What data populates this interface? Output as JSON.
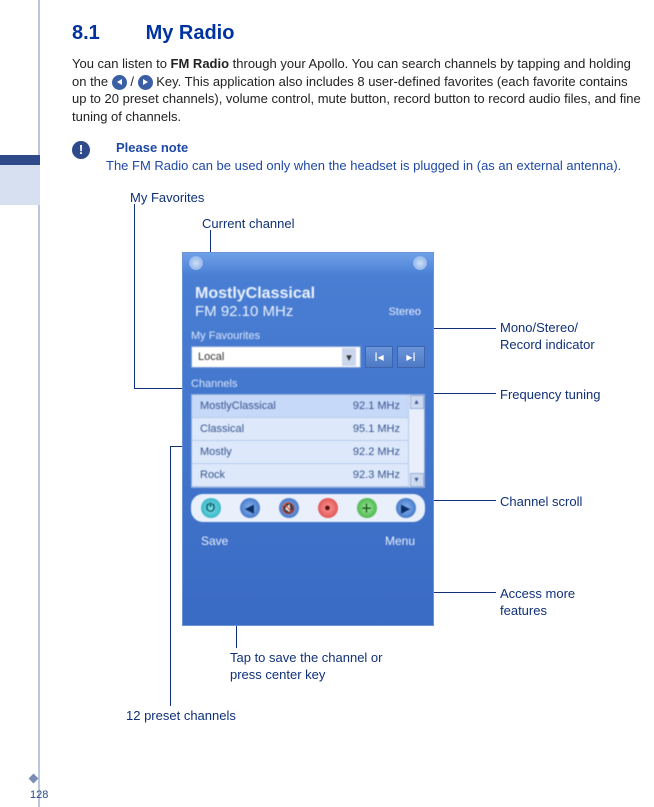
{
  "page_number": "128",
  "heading": {
    "secnum": "8.1",
    "title": "My Radio"
  },
  "para": {
    "pre": "You can listen to ",
    "bold1": "FM Radio",
    "mid1": " through your Apollo. You can search channels by tapping and holding on the ",
    "mid2": " / ",
    "mid3": " Key. This application also includes 8 user-defined favorites (each favorite contains up to 20 preset channels), volume control, mute button, record button to record audio files, and fine tuning of channels."
  },
  "note": {
    "title": "Please note",
    "body": "The FM Radio can be used only when the headset is plugged in (as an external antenna)."
  },
  "callouts": {
    "my_favorites": "My Favorites",
    "current_channel": "Current channel",
    "mono_stereo": "Mono/Stereo/\nRecord indicator",
    "freq_tuning": "Frequency tuning",
    "channel_scroll": "Channel scroll",
    "access_more": "Access more features",
    "tap_save": "Tap to save the channel or press center key",
    "preset_channels": "12 preset channels"
  },
  "shot": {
    "station": "MostlyClassical",
    "freq": "FM 92.10   MHz",
    "stereo": "Stereo",
    "favs_label": "My Favourites",
    "dropdown_value": "Local",
    "channels_label": "Channels",
    "rows": [
      {
        "name": "MostlyClassical",
        "freq": "92.1 MHz"
      },
      {
        "name": "Classical",
        "freq": "95.1 MHz"
      },
      {
        "name": "Mostly",
        "freq": "92.2 MHz"
      },
      {
        "name": "Rock",
        "freq": "92.3 MHz"
      }
    ],
    "soft_left": "Save",
    "soft_right": "Menu"
  }
}
